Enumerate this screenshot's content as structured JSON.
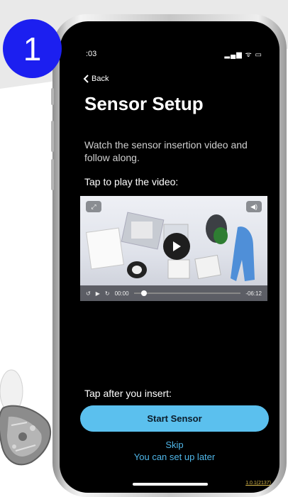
{
  "step_number": "1",
  "status_bar": {
    "time": ":03",
    "icons": "▂▄▆ ᯤ ▭"
  },
  "nav": {
    "back_label": "Back"
  },
  "screen": {
    "title": "Sensor Setup",
    "instruction": "Watch the sensor insertion video and follow along.",
    "video_prompt": "Tap to play the video:",
    "after_prompt": "Tap after you insert:"
  },
  "video": {
    "current_time": "00:00",
    "remaining_time": "-06:12",
    "progress": 0.0,
    "icons": [
      "fullscreen-icon",
      "volume-icon",
      "play-icon",
      "replay-icon",
      "rewind-icon"
    ]
  },
  "actions": {
    "start_label": "Start Sensor",
    "skip_label": "Skip",
    "skip_sub": "You can set up later"
  },
  "footer": {
    "version": "1.0.1(2137)"
  },
  "colors": {
    "badge": "#1c1ff0",
    "start_button": "#5bc0ee",
    "link": "#4fb6e8",
    "screen_bg": "#000000"
  }
}
